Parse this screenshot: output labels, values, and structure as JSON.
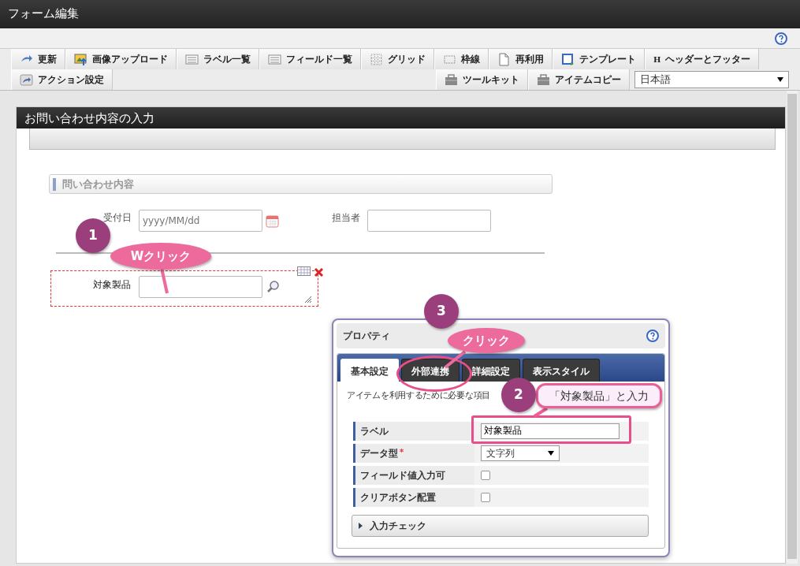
{
  "window": {
    "title": "フォーム編集"
  },
  "toolbar": {
    "row1": [
      {
        "label": "更新"
      },
      {
        "label": "画像アップロード"
      },
      {
        "label": "ラベル一覧"
      },
      {
        "label": "フィールド一覧"
      },
      {
        "label": "グリッド"
      },
      {
        "label": "枠線"
      },
      {
        "label": "再利用"
      },
      {
        "label": "テンプレート"
      },
      {
        "label": "ヘッダーとフッター",
        "glyph": "H"
      }
    ],
    "row2_left": [
      {
        "label": "アクション設定"
      }
    ],
    "row2_right": [
      {
        "label": "ツールキット"
      },
      {
        "label": "アイテムコピー"
      }
    ],
    "language": {
      "value": "日本語"
    }
  },
  "form": {
    "title": "お問い合わせ内容の入力",
    "section": "問い合わせ内容",
    "fields": [
      {
        "label": "受付日",
        "placeholder": "yyyy/MM/dd",
        "date_picker": true
      },
      {
        "label": "担当者",
        "date_picker": false
      }
    ],
    "item": {
      "label": "対象製品",
      "kind": "lookup",
      "selected": true
    }
  },
  "properties": {
    "title": "プロパティ",
    "tabs": [
      {
        "label": "基本設定",
        "selected": true
      },
      {
        "label": "外部連携",
        "selected": false
      },
      {
        "label": "詳細設定",
        "selected": false
      },
      {
        "label": "表示スタイル",
        "selected": false
      }
    ],
    "description": "アイテムを利用するために必要な項目",
    "rows": [
      {
        "label": "ラベル",
        "kind": "text",
        "value": "対象製品"
      },
      {
        "label": "データ型",
        "kind": "select",
        "value": "文字列",
        "required_mark": "*"
      },
      {
        "label": "フィールド値入力可",
        "kind": "checkbox",
        "checked": false
      },
      {
        "label": "クリアボタン配置",
        "kind": "checkbox",
        "checked": false
      }
    ],
    "accordion": {
      "label": "入力チェック",
      "expanded": false
    }
  },
  "annotations": [
    {
      "number": "1",
      "text": "Wクリック",
      "kind": "pink"
    },
    {
      "number": "3",
      "text": "クリック",
      "kind": "pink"
    },
    {
      "number": "2",
      "text": "「対象製品」と入力",
      "kind": "light"
    }
  ]
}
